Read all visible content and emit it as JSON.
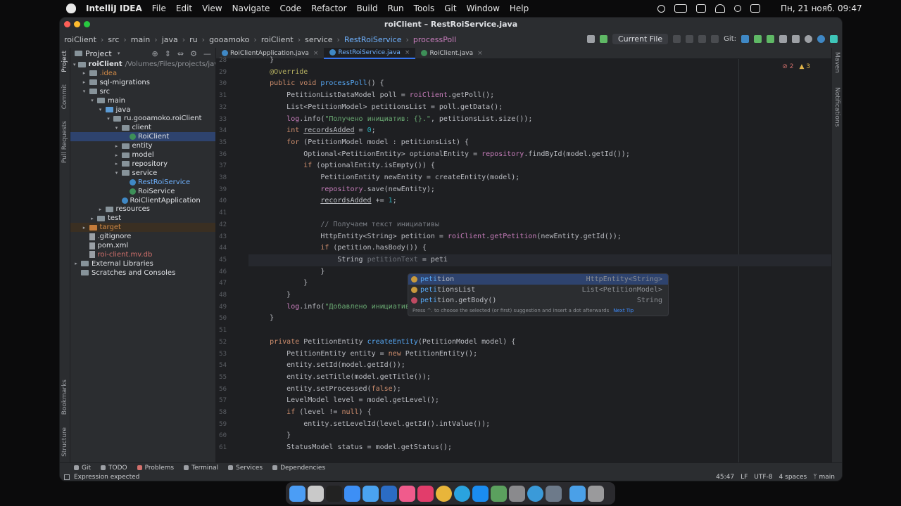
{
  "menubar": {
    "app_name": "IntelliJ IDEA",
    "items": [
      "File",
      "Edit",
      "View",
      "Navigate",
      "Code",
      "Refactor",
      "Build",
      "Run",
      "Tools",
      "Git",
      "Window",
      "Help"
    ],
    "datetime": "Пн, 21 нояб.  09:47"
  },
  "window": {
    "title": "roiClient – RestRoiService.java"
  },
  "breadcrumb": {
    "items": [
      "roiClient",
      "src",
      "main",
      "java",
      "ru",
      "gooamoko",
      "roiClient",
      "service",
      "RestRoiService",
      "processPoll"
    ]
  },
  "toolbar": {
    "run_config": "Current File",
    "git_label": "Git:"
  },
  "project_panel": {
    "title": "Project",
    "tree": [
      {
        "label": "roiClient",
        "suffix": "/Volumes/Files/projects/java/r",
        "depth": 0,
        "kind": "folder",
        "arrow": "▾"
      },
      {
        "label": ".idea",
        "depth": 1,
        "kind": "folder",
        "arrow": "▸",
        "color": "orange"
      },
      {
        "label": "sql-migrations",
        "depth": 1,
        "kind": "folder",
        "arrow": "▸"
      },
      {
        "label": "src",
        "depth": 1,
        "kind": "folder",
        "arrow": "▾"
      },
      {
        "label": "main",
        "depth": 2,
        "kind": "folder",
        "arrow": "▾"
      },
      {
        "label": "java",
        "depth": 3,
        "kind": "src",
        "arrow": "▾"
      },
      {
        "label": "ru.gooamoko.roiClient",
        "depth": 4,
        "kind": "folder",
        "arrow": "▾"
      },
      {
        "label": "client",
        "depth": 5,
        "kind": "folder",
        "arrow": "▾"
      },
      {
        "label": "RoiClient",
        "depth": 6,
        "kind": "class",
        "arrow": "",
        "selected": true
      },
      {
        "label": "entity",
        "depth": 5,
        "kind": "folder",
        "arrow": "▸"
      },
      {
        "label": "model",
        "depth": 5,
        "kind": "folder",
        "arrow": "▸"
      },
      {
        "label": "repository",
        "depth": 5,
        "kind": "folder",
        "arrow": "▸"
      },
      {
        "label": "service",
        "depth": 5,
        "kind": "folder",
        "arrow": "▾"
      },
      {
        "label": "RestRoiService",
        "depth": 6,
        "kind": "class-blue",
        "arrow": "",
        "color": "blue"
      },
      {
        "label": "RoiService",
        "depth": 6,
        "kind": "class",
        "arrow": ""
      },
      {
        "label": "RoiClientApplication",
        "depth": 5,
        "kind": "class-blue",
        "arrow": ""
      },
      {
        "label": "resources",
        "depth": 3,
        "kind": "folder",
        "arrow": "▸"
      },
      {
        "label": "test",
        "depth": 2,
        "kind": "folder",
        "arrow": "▸"
      },
      {
        "label": "target",
        "depth": 1,
        "kind": "orange",
        "arrow": "▸",
        "color": "orange",
        "highlight": true
      },
      {
        "label": ".gitignore",
        "depth": 1,
        "kind": "file",
        "arrow": ""
      },
      {
        "label": "pom.xml",
        "depth": 1,
        "kind": "file",
        "arrow": ""
      },
      {
        "label": "roi-client.mv.db",
        "depth": 1,
        "kind": "file",
        "arrow": "",
        "color": "red"
      },
      {
        "label": "External Libraries",
        "depth": 0,
        "kind": "folder",
        "arrow": "▸"
      },
      {
        "label": "Scratches and Consoles",
        "depth": 0,
        "kind": "folder",
        "arrow": ""
      }
    ]
  },
  "left_stripe": [
    "Project",
    "Commit",
    "Pull Requests",
    "Bookmarks",
    "Structure"
  ],
  "right_stripe": [
    "Maven",
    "Notifications"
  ],
  "tabs": [
    {
      "label": "RoiClientApplication.java",
      "active": false
    },
    {
      "label": "RestRoiService.java",
      "active": true
    },
    {
      "label": "RoiClient.java",
      "active": false
    }
  ],
  "problems": {
    "errors": "2",
    "warnings": "3"
  },
  "editor": {
    "current_line": "45",
    "lines": [
      {
        "n": "28",
        "html": "    }"
      },
      {
        "n": "29",
        "html": "    <span class='ann'>@Override</span>"
      },
      {
        "n": "30",
        "html": "    <span class='kw'>public void</span> <span class='fn'>processPoll</span>() {"
      },
      {
        "n": "31",
        "html": "        PetitionListDataModel poll = <span class='fld'>roiClient</span>.getPoll();"
      },
      {
        "n": "32",
        "html": "        List&lt;PetitionModel&gt; petitionsList = poll.getData();"
      },
      {
        "n": "33",
        "html": "        <span class='fld'>log</span>.info(<span class='str'>\"Получено инициатив: {}.\"</span>, petitionsList.size());"
      },
      {
        "n": "34",
        "html": "        <span class='kw'>int</span> <span class='und'>recordsAdded</span> = <span class='num'>0</span>;"
      },
      {
        "n": "35",
        "html": "        <span class='kw'>for</span> (PetitionModel model : petitionsList) {"
      },
      {
        "n": "36",
        "html": "            Optional&lt;PetitionEntity&gt; optionalEntity = <span class='fld'>repository</span>.findById(model.getId());"
      },
      {
        "n": "37",
        "html": "            <span class='kw'>if</span> (optionalEntity.isEmpty()) {"
      },
      {
        "n": "38",
        "html": "                PetitionEntity newEntity = createEntity(model);"
      },
      {
        "n": "39",
        "html": "                <span class='fld'>repository</span>.save(newEntity);"
      },
      {
        "n": "40",
        "html": "                <span class='und'>recordsAdded</span> += <span class='num'>1</span>;"
      },
      {
        "n": "41",
        "html": ""
      },
      {
        "n": "42",
        "html": "                <span class='cmt'>// Получаем текст инициативы</span>"
      },
      {
        "n": "43",
        "html": "                HttpEntity&lt;String&gt; petition = <span class='fld'>roiClient</span>.<span class='fld'>getPetition</span>(newEntity.getId());"
      },
      {
        "n": "44",
        "html": "                <span class='kw'>if</span> (petition.hasBody()) {"
      },
      {
        "n": "45",
        "html": "                    String <span class='hint'>petitionText</span> = peti"
      },
      {
        "n": "46",
        "html": "                }"
      },
      {
        "n": "47",
        "html": "            }"
      },
      {
        "n": "48",
        "html": "        }"
      },
      {
        "n": "49",
        "html": "        <span class='fld'>log</span>.info(<span class='str'>\"Добавлено инициатив в БД: {}.\"</span>, <span class='und'>recordsAdded</span>);"
      },
      {
        "n": "50",
        "html": "    }"
      },
      {
        "n": "51",
        "html": ""
      },
      {
        "n": "52",
        "html": "    <span class='kw'>private</span> PetitionEntity <span class='fn'>createEntity</span>(PetitionModel model) {"
      },
      {
        "n": "53",
        "html": "        PetitionEntity entity = <span class='kw'>new</span> PetitionEntity();"
      },
      {
        "n": "54",
        "html": "        entity.setId(model.getId());"
      },
      {
        "n": "55",
        "html": "        entity.setTitle(model.getTitle());"
      },
      {
        "n": "56",
        "html": "        entity.setProcessed(<span class='kw'>false</span>);"
      },
      {
        "n": "57",
        "html": "        LevelModel level = model.getLevel();"
      },
      {
        "n": "58",
        "html": "        <span class='kw'>if</span> (level != <span class='kw'>null</span>) {"
      },
      {
        "n": "59",
        "html": "            entity.setLevelId(level.getId().intValue());"
      },
      {
        "n": "60",
        "html": "        }"
      },
      {
        "n": "61",
        "html": "        StatusModel status = model.getStatus();"
      }
    ]
  },
  "completion": {
    "items": [
      {
        "prefix": "peti",
        "rest": "tion",
        "type": "HttpEntity<String>",
        "kind": "var",
        "selected": true
      },
      {
        "prefix": "peti",
        "rest": "tionsList",
        "type": "List<PetitionModel>",
        "kind": "var",
        "selected": false
      },
      {
        "prefix": "peti",
        "rest": "tion.getBody()",
        "type": "String",
        "kind": "method",
        "selected": false
      }
    ],
    "tip": "Press ^. to choose the selected (or first) suggestion and insert a dot afterwards",
    "next_tip": "Next Tip"
  },
  "tool_windows": [
    "Git",
    "TODO",
    "Problems",
    "Terminal",
    "Services",
    "Dependencies"
  ],
  "status_bar": {
    "message": "Expression expected",
    "position": "45:47",
    "line_sep": "LF",
    "encoding": "UTF-8",
    "indent": "4 spaces",
    "branch": "main"
  },
  "colors": {
    "accent": "#3574f0",
    "editor_bg": "#1e1f22",
    "panel_bg": "#2b2d30",
    "selection": "#2e436e"
  }
}
